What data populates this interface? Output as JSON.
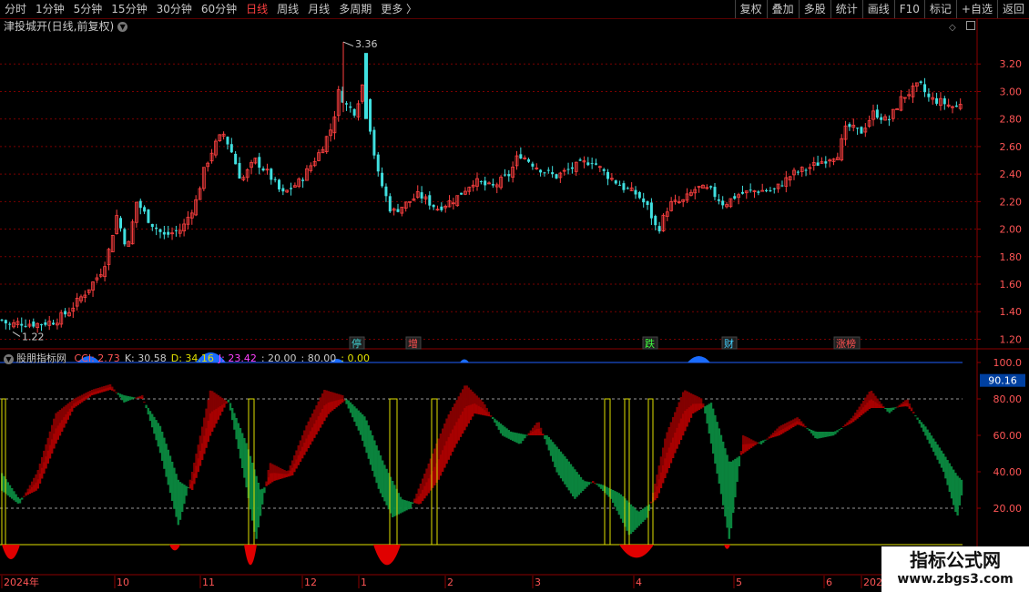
{
  "toolbar": {
    "periods": [
      "分时",
      "1分钟",
      "5分钟",
      "15分钟",
      "30分钟",
      "60分钟",
      "日线",
      "周线",
      "月线",
      "多周期",
      "更多 〉"
    ],
    "active_period": "日线",
    "buttons": [
      "复权",
      "叠加",
      "多股",
      "统计",
      "画线",
      "F10",
      "标记",
      "+自选",
      "返回"
    ]
  },
  "stock_title": "津投城开(日线,前复权)",
  "main_chart": {
    "price_axis_ticks": [
      "3.20",
      "3.00",
      "2.80",
      "2.60",
      "2.40",
      "2.20",
      "2.00",
      "1.80",
      "1.60",
      "1.40",
      "1.20"
    ],
    "high_label": "3.36",
    "low_label": "1.22",
    "markers": [
      {
        "text": "停",
        "color": "#40d0d0"
      },
      {
        "text": "增",
        "color": "#ff5050"
      },
      {
        "text": "跌",
        "color": "#40ff40"
      },
      {
        "text": "财",
        "color": "#40d0ff"
      },
      {
        "text": "涨榜",
        "color": "#ff5050"
      }
    ]
  },
  "indicator": {
    "name": "股朋指标网",
    "values": [
      {
        "label": "CCI: 2.73",
        "color": "#ff5555"
      },
      {
        "label": "K: 30.58",
        "color": "#c8c8c8"
      },
      {
        "label": "D: 34.16",
        "color": "#e0e000"
      },
      {
        "label": "J: 23.42",
        "color": "#ff40ff"
      },
      {
        "label": ": 20.00",
        "color": "#c8c8c8"
      },
      {
        "label": ": 80.00",
        "color": "#c8c8c8"
      },
      {
        "label": ": 0.00",
        "color": "#e0e000"
      }
    ],
    "axis_ticks": [
      "100.0",
      "80.00",
      "60.00",
      "40.00",
      "20.00"
    ],
    "current_value": "90.16"
  },
  "date_axis": [
    "2024年",
    "10",
    "11",
    "12",
    "1",
    "2",
    "3",
    "4",
    "5",
    "6",
    "2025"
  ],
  "watermark": {
    "line1": "指标公式网",
    "line2": "www.zbgs3.com"
  },
  "chart_data": {
    "type": "candlestick",
    "y_range_main": [
      1.15,
      3.4
    ],
    "y_range_indicator": [
      0,
      100
    ],
    "reference_lines": [
      20,
      80,
      100
    ],
    "up_color": "#ff4040",
    "down_color": "#40e0e0"
  }
}
